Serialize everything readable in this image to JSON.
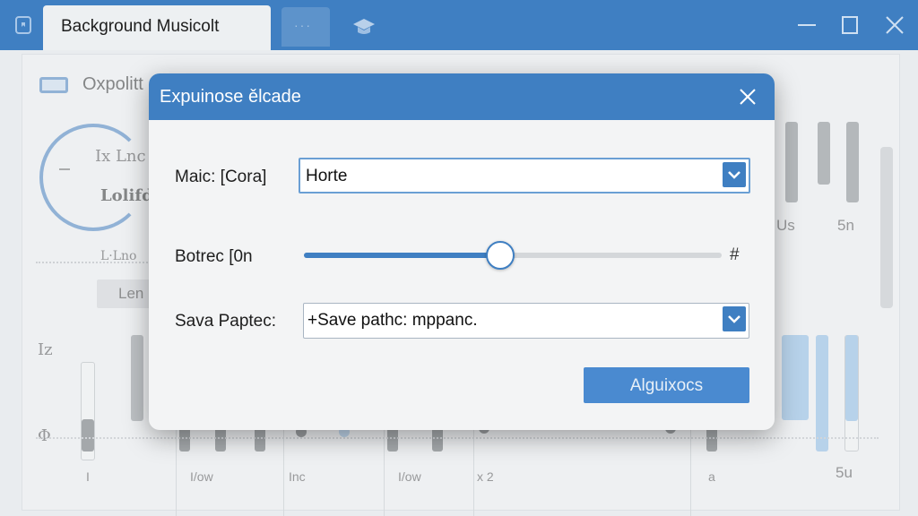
{
  "window": {
    "tab_title": "Background Musicolt",
    "ghost_tab": "···",
    "accent": "#3f7fc2",
    "icons": [
      "app-icon",
      "graduation-cap-icon",
      "minimize-icon",
      "maximize-icon",
      "close-icon"
    ]
  },
  "background": {
    "header_text": "Oxpolitt",
    "knob_top_text": "Ix Lnc",
    "knob_bottom_text": "Lolifd",
    "dash_text": "L·Lno",
    "button_label": "Len",
    "left_mark_1": "Iz",
    "left_mark_2": "Φ",
    "right_label_1": "Us",
    "right_label_2": "5n",
    "channel_labels": [
      "I",
      "I/ow",
      "Inc",
      "I/ow",
      "x 2",
      "a",
      "5u"
    ]
  },
  "dialog": {
    "title": "Expuinose ělcade",
    "row1_label": "Maic: [Cora]",
    "row1_value": "Horte",
    "row2_label": "Botrec [0n",
    "row2_end_symbol": "#",
    "slider_level": 0.47,
    "row3_label": "Sava Paptec:",
    "row3_value": "+Save pathc: mppanc.",
    "primary_button": "Alguixocs"
  }
}
